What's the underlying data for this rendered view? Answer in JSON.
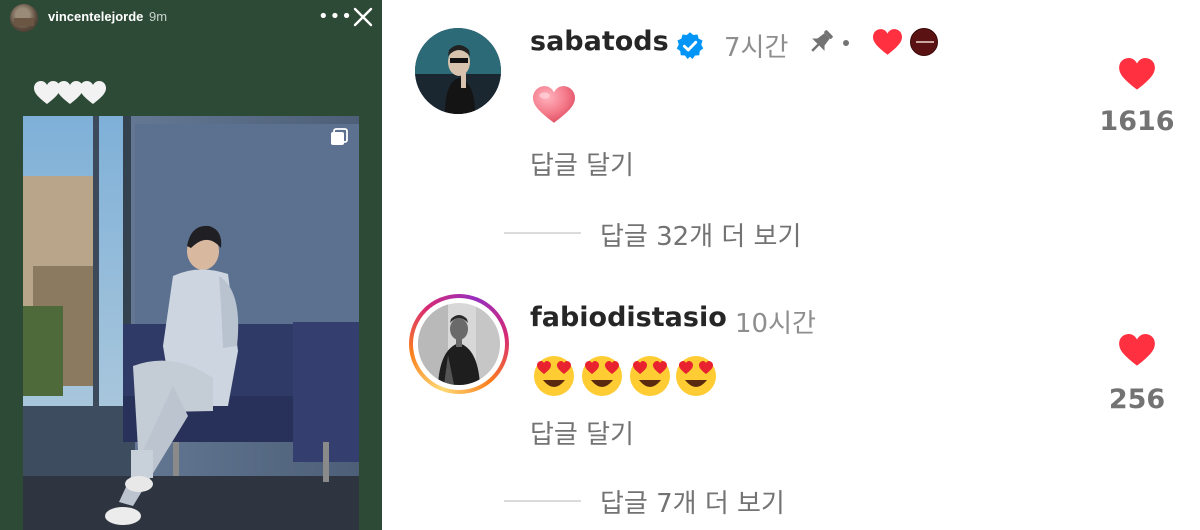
{
  "story": {
    "username": "vincentelejorde",
    "time": "9m",
    "caption_icons": "white-hearts"
  },
  "comments": [
    {
      "username": "sabatods",
      "verified": true,
      "time": "7시간",
      "pinned": true,
      "liked_by_author": true,
      "body_emoji": "pink-heart",
      "reply_label": "답글 달기",
      "view_replies_label": "답글 32개 더 보기",
      "like_count": "1616"
    },
    {
      "username": "fabiodistasio",
      "verified": false,
      "time": "10시간",
      "body_emoji": "heart-eyes x4",
      "reply_label": "답글 달기",
      "view_replies_label": "답글 7개 더 보기",
      "like_count": "256"
    }
  ],
  "colors": {
    "like_red": "#ff3040",
    "verified_blue": "#0095f6",
    "story_background": "#2c4a36",
    "story_ring": "#d6249f"
  }
}
